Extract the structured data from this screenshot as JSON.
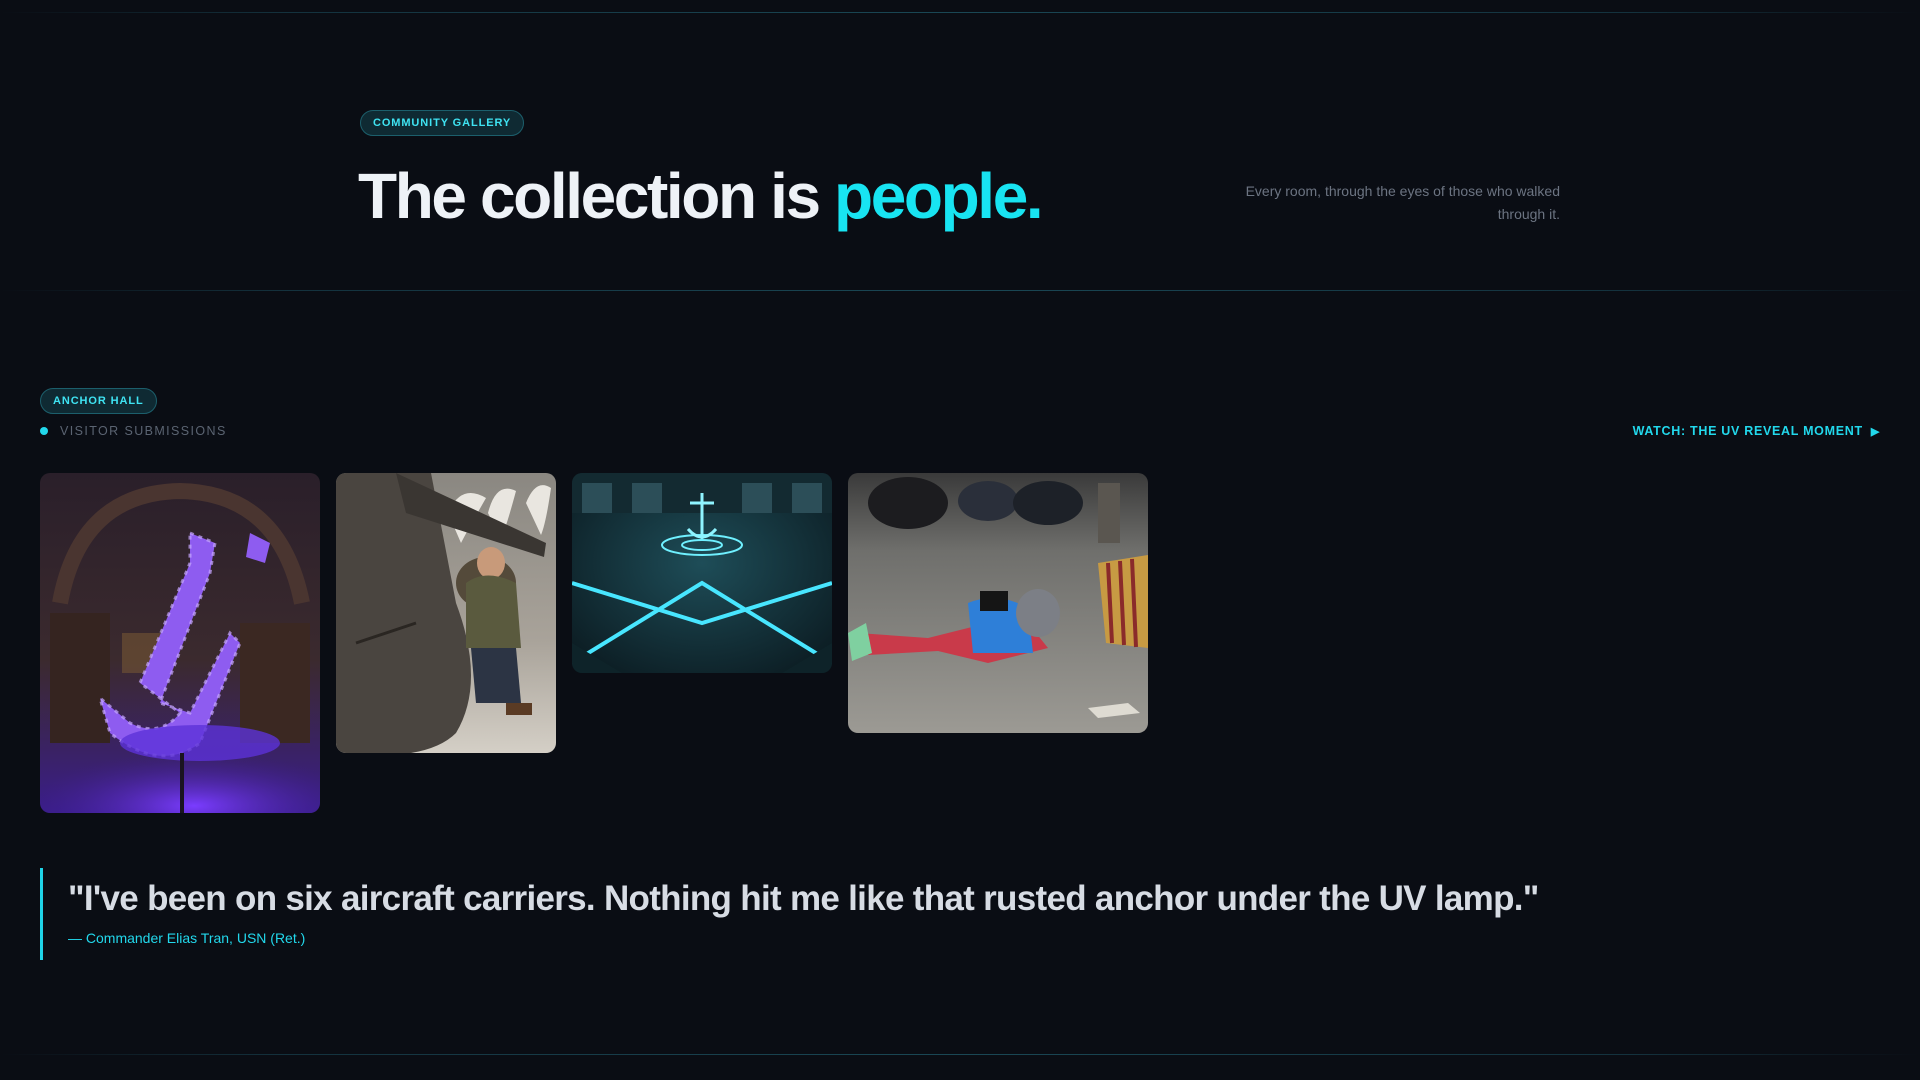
{
  "hero": {
    "badge": "COMMUNITY GALLERY",
    "title_main": "The collection is ",
    "title_accent": "people.",
    "subtitle": "Every room, through the eyes of those who walked through it."
  },
  "section": {
    "badge": "ANCHOR HALL",
    "label": "VISITOR SUBMISSIONS",
    "watch_link": "WATCH: THE UV REVEAL MOMENT",
    "watch_icon": "play-triangle-icon"
  },
  "gallery": {
    "photos": [
      {
        "name": "purple-uv-anchor-sculpture"
      },
      {
        "name": "visitor-examining-rusted-anchor"
      },
      {
        "name": "glowing-anchor-hall-overhead"
      },
      {
        "name": "person-lying-on-street-with-tablet"
      }
    ]
  },
  "quote": {
    "text": "\"I've been on six aircraft carriers. Nothing hit me like that rusted anchor under the UV lamp.\"",
    "author": "— Commander Elias Tran, USN (Ret.)"
  },
  "colors": {
    "background": "#0a0d14",
    "accent": "#18e4f2",
    "pill_border": "#1c5f6c",
    "muted_text": "#6c7482"
  }
}
